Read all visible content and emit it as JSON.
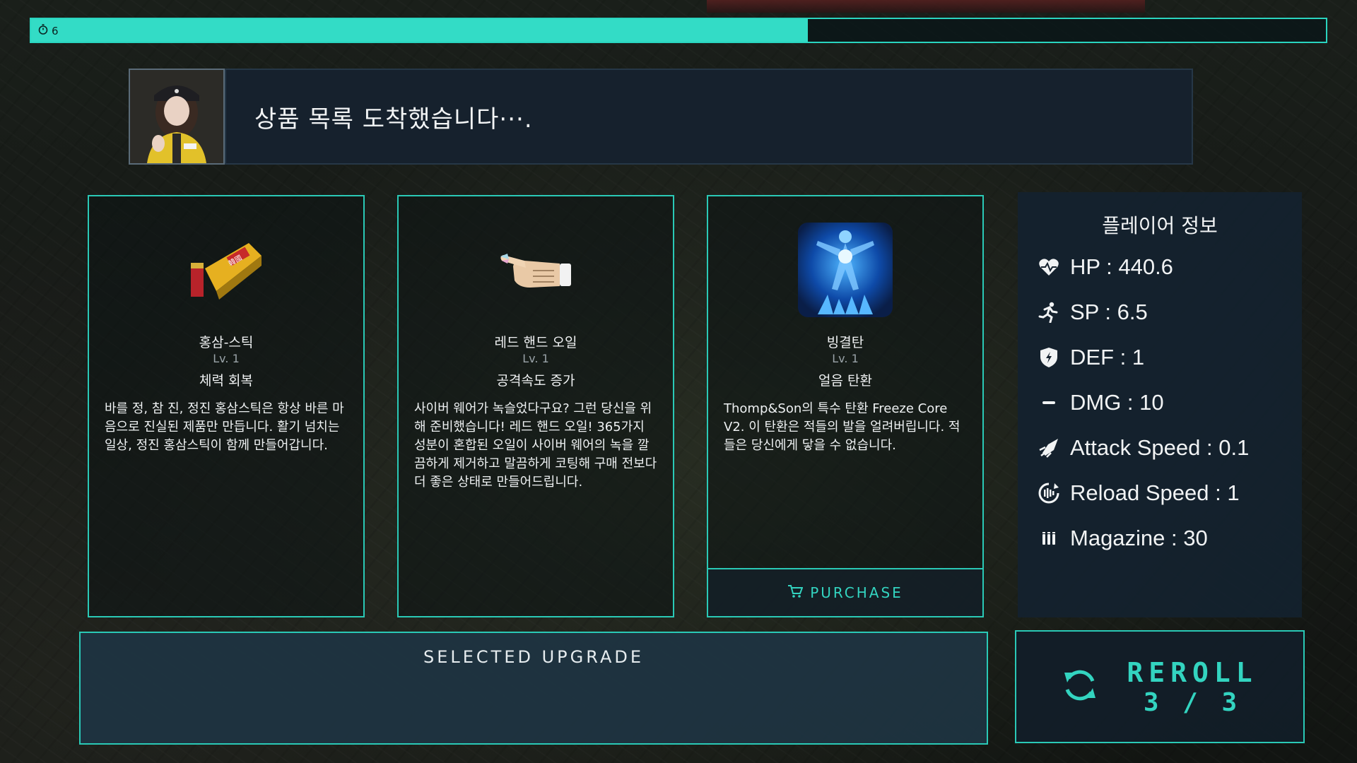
{
  "timer": {
    "value": "6",
    "icon": "stopwatch-icon",
    "progress": 0.6,
    "color": "#33dcc6"
  },
  "dialogue": {
    "text": "상품 목록 도착했습니다···."
  },
  "cards": [
    {
      "icon": "ginseng-stick-icon",
      "name": "홍삼-스틱",
      "level": "Lv. 1",
      "type": "체력 회복",
      "description": "바를 정, 참 진, 정진 홍삼스틱은 항상 바른 마음으로 진실된 제품만 만듭니다. 활기 넘치는 일상, 정진 홍삼스틱이 함께 만들어갑니다."
    },
    {
      "icon": "hand-oil-icon",
      "name": "레드 핸드 오일",
      "level": "Lv. 1",
      "type": "공격속도 증가",
      "description": "사이버 웨어가 녹슬었다구요? 그런 당신을 위해 준비했습니다! 레드 핸드 오일! 365가지 성분이 혼합된 오일이 사이버 웨어의 녹을 깔끔하게 제거하고 말끔하게 코팅해 구매 전보다 더 좋은 상태로 만들어드립니다."
    },
    {
      "icon": "freeze-bullet-icon",
      "name": "빙결탄",
      "level": "Lv. 1",
      "type": "얼음 탄환",
      "description": "Thomp&Son의 특수 탄환 Freeze Core V2. 이 탄환은 적들의 발을 얼려버립니다. 적들은 당신에게 닿을 수 없습니다.",
      "purchase_label": "PURCHASE"
    }
  ],
  "player": {
    "title": "플레이어 정보",
    "stats": [
      {
        "icon": "heart-icon",
        "text": "HP :  440.6"
      },
      {
        "icon": "running-icon",
        "text": "SP : 6.5"
      },
      {
        "icon": "shield-icon",
        "text": "DEF :   1"
      },
      {
        "icon": "bullet-icon",
        "text": "DMG :  10"
      },
      {
        "icon": "speed-icon",
        "text": "Attack Speed : 0.1"
      },
      {
        "icon": "reload-icon",
        "text": "Reload Speed : 1"
      },
      {
        "icon": "magazine-icon",
        "text": "Magazine : 30"
      }
    ]
  },
  "selected": {
    "label": "SELECTED UPGRADE"
  },
  "reroll": {
    "label": "REROLL",
    "count": "3 / 3",
    "icon": "refresh-icon"
  },
  "colors": {
    "accent": "#2ac9b6",
    "panel": "#14212e",
    "text": "#eef1f2"
  }
}
